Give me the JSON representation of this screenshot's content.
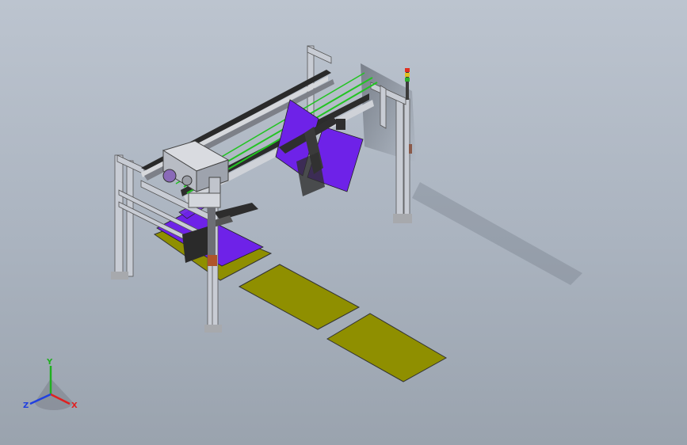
{
  "viewport": {
    "triad": {
      "x_label": "X",
      "y_label": "Y",
      "z_label": "Z",
      "x_color": "#e02020",
      "y_color": "#20b020",
      "z_color": "#2040e0"
    }
  },
  "model": {
    "frame_color": "#c8ccd4",
    "panel_color": "#6e22e8",
    "pallet_color": "#8f8f00",
    "rail_accent_color": "#22c422",
    "tower_light_colors": [
      "#e03020",
      "#e0c020",
      "#30b030"
    ]
  }
}
